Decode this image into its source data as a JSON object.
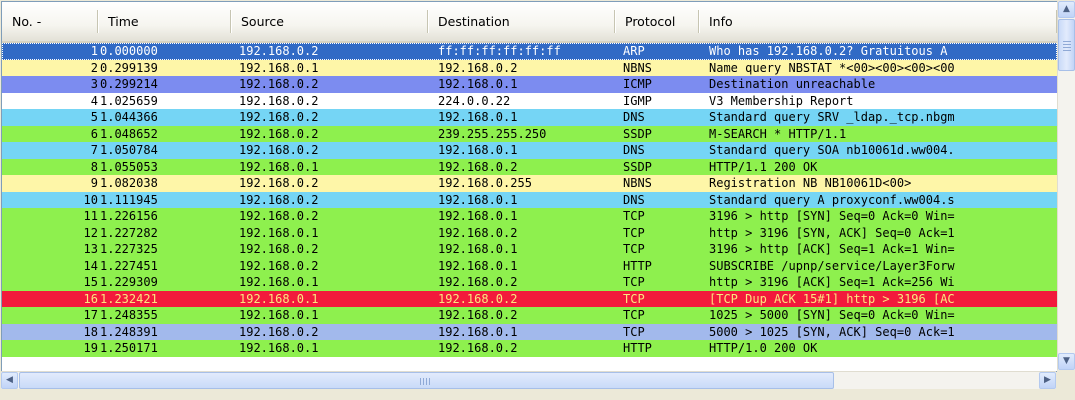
{
  "columns": [
    {
      "key": "no",
      "label": "No. -"
    },
    {
      "key": "time",
      "label": "Time"
    },
    {
      "key": "source",
      "label": "Source"
    },
    {
      "key": "destination",
      "label": "Destination"
    },
    {
      "key": "protocol",
      "label": "Protocol"
    },
    {
      "key": "info",
      "label": "Info"
    }
  ],
  "colors": {
    "selected": {
      "bg": "#316ac5",
      "fg": "#ffffff"
    },
    "nbns": {
      "bg": "#fef6a8",
      "fg": "#000000"
    },
    "icmp": {
      "bg": "#7c8cf0",
      "fg": "#000000"
    },
    "igmp": {
      "bg": "#ffffff",
      "fg": "#000000"
    },
    "dns": {
      "bg": "#75d5f5",
      "fg": "#000000"
    },
    "green": {
      "bg": "#8ef04e",
      "fg": "#000000"
    },
    "tcp_problem": {
      "bg": "#f21a3c",
      "fg": "#fee47f"
    },
    "tcp_blue": {
      "bg": "#a2b9ec",
      "fg": "#000000"
    }
  },
  "packets": [
    {
      "no": "1",
      "time": "0.000000",
      "source": "192.168.0.2",
      "destination": "ff:ff:ff:ff:ff:ff",
      "protocol": "ARP",
      "info": "Who has 192.168.0.2?  Gratuitous A",
      "color": "selected",
      "selected": true
    },
    {
      "no": "2",
      "time": "0.299139",
      "source": "192.168.0.1",
      "destination": "192.168.0.2",
      "protocol": "NBNS",
      "info": "Name query NBSTAT *<00><00><00><00",
      "color": "nbns"
    },
    {
      "no": "3",
      "time": "0.299214",
      "source": "192.168.0.2",
      "destination": "192.168.0.1",
      "protocol": "ICMP",
      "info": "Destination unreachable",
      "color": "icmp"
    },
    {
      "no": "4",
      "time": "1.025659",
      "source": "192.168.0.2",
      "destination": "224.0.0.22",
      "protocol": "IGMP",
      "info": "V3 Membership Report",
      "color": "igmp"
    },
    {
      "no": "5",
      "time": "1.044366",
      "source": "192.168.0.2",
      "destination": "192.168.0.1",
      "protocol": "DNS",
      "info": "Standard query SRV _ldap._tcp.nbgm",
      "color": "dns"
    },
    {
      "no": "6",
      "time": "1.048652",
      "source": "192.168.0.2",
      "destination": "239.255.255.250",
      "protocol": "SSDP",
      "info": "M-SEARCH * HTTP/1.1",
      "color": "green"
    },
    {
      "no": "7",
      "time": "1.050784",
      "source": "192.168.0.2",
      "destination": "192.168.0.1",
      "protocol": "DNS",
      "info": "Standard query SOA nb10061d.ww004.",
      "color": "dns"
    },
    {
      "no": "8",
      "time": "1.055053",
      "source": "192.168.0.1",
      "destination": "192.168.0.2",
      "protocol": "SSDP",
      "info": "HTTP/1.1 200 OK",
      "color": "green"
    },
    {
      "no": "9",
      "time": "1.082038",
      "source": "192.168.0.2",
      "destination": "192.168.0.255",
      "protocol": "NBNS",
      "info": "Registration NB NB10061D<00>",
      "color": "nbns"
    },
    {
      "no": "10",
      "time": "1.111945",
      "source": "192.168.0.2",
      "destination": "192.168.0.1",
      "protocol": "DNS",
      "info": "Standard query A proxyconf.ww004.s",
      "color": "dns"
    },
    {
      "no": "11",
      "time": "1.226156",
      "source": "192.168.0.2",
      "destination": "192.168.0.1",
      "protocol": "TCP",
      "info": "3196 > http [SYN] Seq=0 Ack=0 Win=",
      "color": "green"
    },
    {
      "no": "12",
      "time": "1.227282",
      "source": "192.168.0.1",
      "destination": "192.168.0.2",
      "protocol": "TCP",
      "info": "http > 3196 [SYN, ACK] Seq=0 Ack=1",
      "color": "green"
    },
    {
      "no": "13",
      "time": "1.227325",
      "source": "192.168.0.2",
      "destination": "192.168.0.1",
      "protocol": "TCP",
      "info": "3196 > http [ACK] Seq=1 Ack=1 Win=",
      "color": "green"
    },
    {
      "no": "14",
      "time": "1.227451",
      "source": "192.168.0.2",
      "destination": "192.168.0.1",
      "protocol": "HTTP",
      "info": "SUBSCRIBE /upnp/service/Layer3Forw",
      "color": "green"
    },
    {
      "no": "15",
      "time": "1.229309",
      "source": "192.168.0.1",
      "destination": "192.168.0.2",
      "protocol": "TCP",
      "info": "http > 3196 [ACK] Seq=1 Ack=256 Wi",
      "color": "green"
    },
    {
      "no": "16",
      "time": "1.232421",
      "source": "192.168.0.1",
      "destination": "192.168.0.2",
      "protocol": "TCP",
      "info": "[TCP Dup ACK 15#1] http > 3196 [AC",
      "color": "tcp_problem"
    },
    {
      "no": "17",
      "time": "1.248355",
      "source": "192.168.0.1",
      "destination": "192.168.0.2",
      "protocol": "TCP",
      "info": "1025 > 5000 [SYN] Seq=0 Ack=0 Win=",
      "color": "green"
    },
    {
      "no": "18",
      "time": "1.248391",
      "source": "192.168.0.2",
      "destination": "192.168.0.1",
      "protocol": "TCP",
      "info": "5000 > 1025 [SYN, ACK] Seq=0 Ack=1",
      "color": "tcp_blue"
    },
    {
      "no": "19",
      "time": "1.250171",
      "source": "192.168.0.1",
      "destination": "192.168.0.2",
      "protocol": "HTTP",
      "info": "HTTP/1.0 200 OK",
      "color": "green"
    }
  ],
  "scrollbars": {
    "up_arrow": "up-arrow-icon",
    "down_arrow": "down-arrow-icon",
    "left_arrow": "left-arrow-icon",
    "right_arrow": "right-arrow-icon",
    "up_glyph": "▲",
    "down_glyph": "▼",
    "left_glyph": "◀",
    "right_glyph": "▶"
  }
}
